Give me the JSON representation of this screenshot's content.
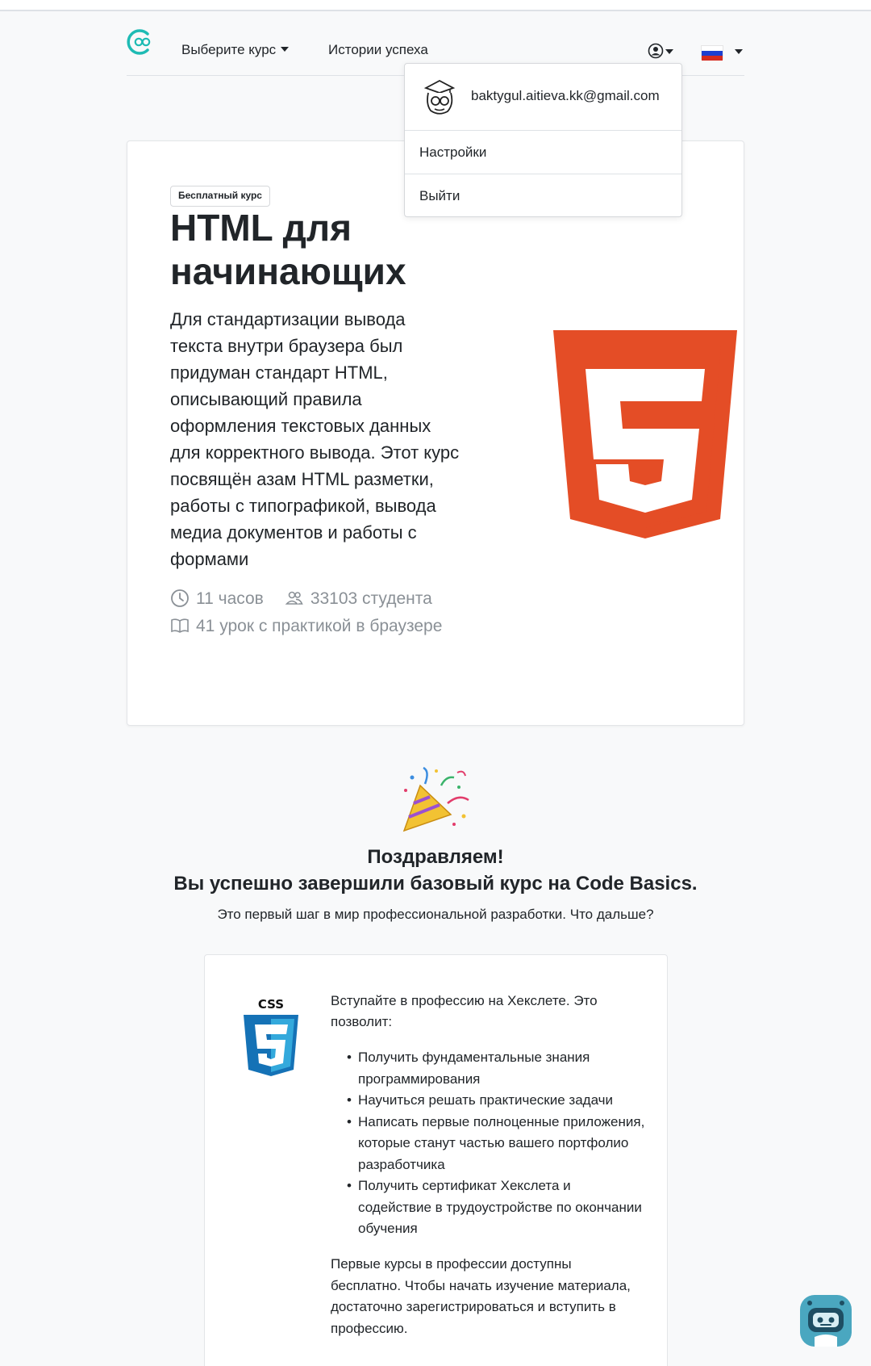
{
  "navbar": {
    "logo_alt": "Code Basics",
    "courses_label": "Выберите курс",
    "stories_label": "Истории успеха",
    "language": "ru"
  },
  "user_menu": {
    "email": "baktygul.aitieva.kk@gmail.com",
    "items": [
      {
        "label": "Настройки"
      },
      {
        "label": "Выйти"
      }
    ]
  },
  "course": {
    "badge": "Бесплатный курс",
    "title": "HTML для начинающих",
    "description": "Для стандартизации вывода текста внутри браузера был придуман стандарт HTML, описывающий правила оформления текстовых данных для корректного вывода. Этот курс посвящён азам HTML разметки, работы с типографикой, вывода медиа документов и работы с формами",
    "duration": "11 часов",
    "students": "33103 студента",
    "lessons": "41 урок с практикой в браузере",
    "logo_color": "#e44d26"
  },
  "congrats": {
    "title": "Поздравляем!",
    "subtitle": "Вы успешно завершили базовый курс на Code Basics.",
    "note": "Это первый шаг в мир профессиональной разработки. Что дальше?"
  },
  "promo": {
    "intro": "Вступайте в профессию на Хекслете. Это позволит:",
    "benefits": [
      "Получить фундаментальные знания программирования",
      "Научиться решать практические задачи",
      "Написать первые полноценные приложения, которые станут частью вашего портфолио разработчика",
      "Получить сертификат Хекслета и содействие в трудоустройстве по окончании обучения"
    ],
    "outro": "Первые курсы в профессии доступны бесплатно. Чтобы начать изучение материала, достаточно зарегистрироваться и вступить в профессию.",
    "logo_label": "CSS"
  },
  "colors": {
    "accent": "#1ebbb4",
    "html5": "#e44d26",
    "css3": "#1572b6",
    "muted": "#8a9096"
  }
}
